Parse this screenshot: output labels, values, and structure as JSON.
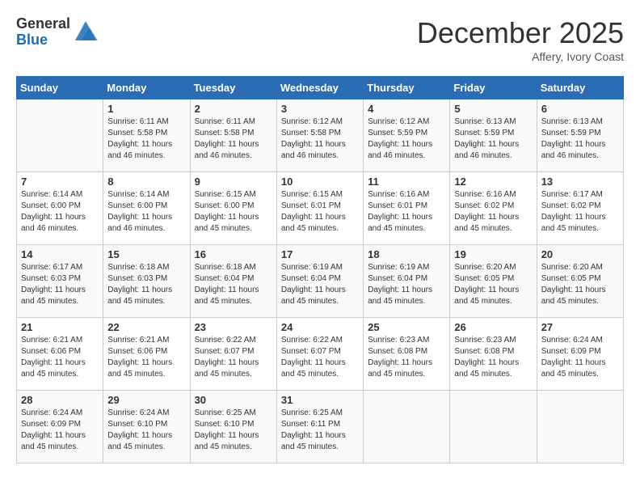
{
  "logo": {
    "general": "General",
    "blue": "Blue"
  },
  "title": "December 2025",
  "subtitle": "Affery, Ivory Coast",
  "days_of_week": [
    "Sunday",
    "Monday",
    "Tuesday",
    "Wednesday",
    "Thursday",
    "Friday",
    "Saturday"
  ],
  "weeks": [
    [
      {
        "day": "",
        "sunrise": "",
        "sunset": "",
        "daylight": ""
      },
      {
        "day": "1",
        "sunrise": "6:11 AM",
        "sunset": "5:58 PM",
        "daylight": "11 hours and 46 minutes."
      },
      {
        "day": "2",
        "sunrise": "6:11 AM",
        "sunset": "5:58 PM",
        "daylight": "11 hours and 46 minutes."
      },
      {
        "day": "3",
        "sunrise": "6:12 AM",
        "sunset": "5:58 PM",
        "daylight": "11 hours and 46 minutes."
      },
      {
        "day": "4",
        "sunrise": "6:12 AM",
        "sunset": "5:59 PM",
        "daylight": "11 hours and 46 minutes."
      },
      {
        "day": "5",
        "sunrise": "6:13 AM",
        "sunset": "5:59 PM",
        "daylight": "11 hours and 46 minutes."
      },
      {
        "day": "6",
        "sunrise": "6:13 AM",
        "sunset": "5:59 PM",
        "daylight": "11 hours and 46 minutes."
      }
    ],
    [
      {
        "day": "7",
        "sunrise": "6:14 AM",
        "sunset": "6:00 PM",
        "daylight": "11 hours and 46 minutes."
      },
      {
        "day": "8",
        "sunrise": "6:14 AM",
        "sunset": "6:00 PM",
        "daylight": "11 hours and 46 minutes."
      },
      {
        "day": "9",
        "sunrise": "6:15 AM",
        "sunset": "6:00 PM",
        "daylight": "11 hours and 45 minutes."
      },
      {
        "day": "10",
        "sunrise": "6:15 AM",
        "sunset": "6:01 PM",
        "daylight": "11 hours and 45 minutes."
      },
      {
        "day": "11",
        "sunrise": "6:16 AM",
        "sunset": "6:01 PM",
        "daylight": "11 hours and 45 minutes."
      },
      {
        "day": "12",
        "sunrise": "6:16 AM",
        "sunset": "6:02 PM",
        "daylight": "11 hours and 45 minutes."
      },
      {
        "day": "13",
        "sunrise": "6:17 AM",
        "sunset": "6:02 PM",
        "daylight": "11 hours and 45 minutes."
      }
    ],
    [
      {
        "day": "14",
        "sunrise": "6:17 AM",
        "sunset": "6:03 PM",
        "daylight": "11 hours and 45 minutes."
      },
      {
        "day": "15",
        "sunrise": "6:18 AM",
        "sunset": "6:03 PM",
        "daylight": "11 hours and 45 minutes."
      },
      {
        "day": "16",
        "sunrise": "6:18 AM",
        "sunset": "6:04 PM",
        "daylight": "11 hours and 45 minutes."
      },
      {
        "day": "17",
        "sunrise": "6:19 AM",
        "sunset": "6:04 PM",
        "daylight": "11 hours and 45 minutes."
      },
      {
        "day": "18",
        "sunrise": "6:19 AM",
        "sunset": "6:04 PM",
        "daylight": "11 hours and 45 minutes."
      },
      {
        "day": "19",
        "sunrise": "6:20 AM",
        "sunset": "6:05 PM",
        "daylight": "11 hours and 45 minutes."
      },
      {
        "day": "20",
        "sunrise": "6:20 AM",
        "sunset": "6:05 PM",
        "daylight": "11 hours and 45 minutes."
      }
    ],
    [
      {
        "day": "21",
        "sunrise": "6:21 AM",
        "sunset": "6:06 PM",
        "daylight": "11 hours and 45 minutes."
      },
      {
        "day": "22",
        "sunrise": "6:21 AM",
        "sunset": "6:06 PM",
        "daylight": "11 hours and 45 minutes."
      },
      {
        "day": "23",
        "sunrise": "6:22 AM",
        "sunset": "6:07 PM",
        "daylight": "11 hours and 45 minutes."
      },
      {
        "day": "24",
        "sunrise": "6:22 AM",
        "sunset": "6:07 PM",
        "daylight": "11 hours and 45 minutes."
      },
      {
        "day": "25",
        "sunrise": "6:23 AM",
        "sunset": "6:08 PM",
        "daylight": "11 hours and 45 minutes."
      },
      {
        "day": "26",
        "sunrise": "6:23 AM",
        "sunset": "6:08 PM",
        "daylight": "11 hours and 45 minutes."
      },
      {
        "day": "27",
        "sunrise": "6:24 AM",
        "sunset": "6:09 PM",
        "daylight": "11 hours and 45 minutes."
      }
    ],
    [
      {
        "day": "28",
        "sunrise": "6:24 AM",
        "sunset": "6:09 PM",
        "daylight": "11 hours and 45 minutes."
      },
      {
        "day": "29",
        "sunrise": "6:24 AM",
        "sunset": "6:10 PM",
        "daylight": "11 hours and 45 minutes."
      },
      {
        "day": "30",
        "sunrise": "6:25 AM",
        "sunset": "6:10 PM",
        "daylight": "11 hours and 45 minutes."
      },
      {
        "day": "31",
        "sunrise": "6:25 AM",
        "sunset": "6:11 PM",
        "daylight": "11 hours and 45 minutes."
      },
      {
        "day": "",
        "sunrise": "",
        "sunset": "",
        "daylight": ""
      },
      {
        "day": "",
        "sunrise": "",
        "sunset": "",
        "daylight": ""
      },
      {
        "day": "",
        "sunrise": "",
        "sunset": "",
        "daylight": ""
      }
    ]
  ],
  "labels": {
    "sunrise": "Sunrise:",
    "sunset": "Sunset:",
    "daylight": "Daylight:"
  }
}
